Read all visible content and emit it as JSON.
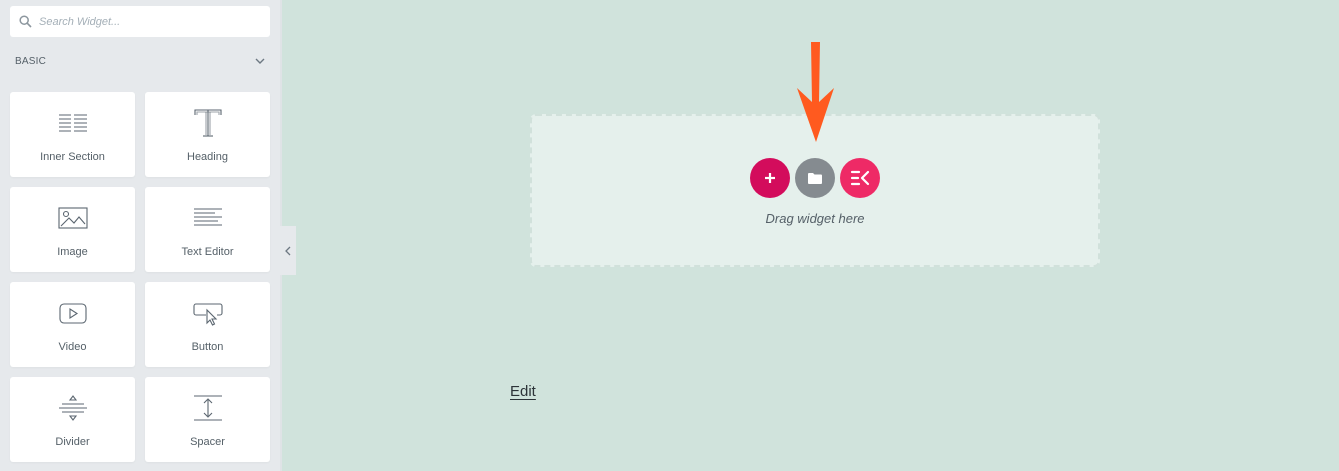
{
  "search": {
    "placeholder": "Search Widget..."
  },
  "category": {
    "title": "BASIC"
  },
  "widgets": [
    {
      "label": "Inner Section",
      "icon": "inner-section-icon"
    },
    {
      "label": "Heading",
      "icon": "heading-icon"
    },
    {
      "label": "Image",
      "icon": "image-icon"
    },
    {
      "label": "Text Editor",
      "icon": "text-editor-icon"
    },
    {
      "label": "Video",
      "icon": "video-icon"
    },
    {
      "label": "Button",
      "icon": "button-icon"
    },
    {
      "label": "Divider",
      "icon": "divider-icon"
    },
    {
      "label": "Spacer",
      "icon": "spacer-icon"
    }
  ],
  "canvas": {
    "drop_text": "Drag widget here",
    "edit_link": "Edit"
  },
  "colors": {
    "canvas_bg": "#d0e3dc",
    "add_button": "#d30c5c",
    "template_button": "#858b90",
    "ek_button": "#ee2a66",
    "arrow": "#ff5a1f"
  }
}
